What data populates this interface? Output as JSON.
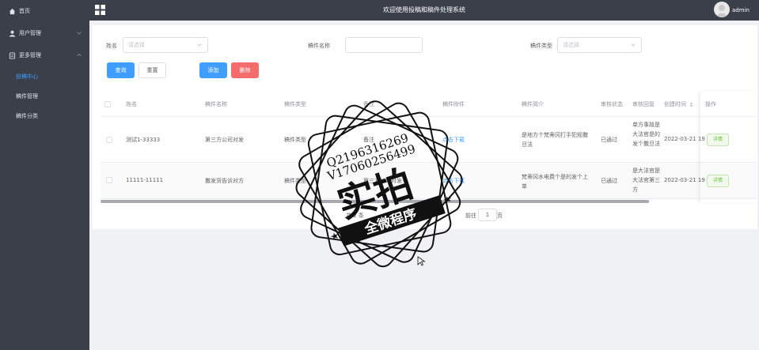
{
  "sidebar": {
    "items": [
      {
        "label": "首页",
        "icon": "home-icon"
      },
      {
        "label": "用户管理",
        "icon": "user-icon"
      },
      {
        "label": "更多管理",
        "icon": "document-icon"
      }
    ],
    "sub_items": [
      {
        "label": "投稿中心",
        "active": true
      },
      {
        "label": "稿件管理",
        "active": false
      },
      {
        "label": "稿件分类",
        "active": false
      }
    ]
  },
  "header": {
    "title": "欢迎使用投稿和稿件处理系统",
    "username": "admin"
  },
  "filters": {
    "name_label": "姓名",
    "name_placeholder": "请选择",
    "manuscript_name_label": "稿件名称",
    "manuscript_name_value": "",
    "manuscript_type_label": "稿件类型",
    "manuscript_type_placeholder": "请选择"
  },
  "buttons": {
    "query": "查询",
    "reset": "重置",
    "add": "添加",
    "delete": "删除"
  },
  "table": {
    "columns": [
      "姓名",
      "稿件名称",
      "稿件类型",
      "备注",
      "稿件附件",
      "稿件简介",
      "审核状态",
      "审核回复",
      "创建时间",
      "操作"
    ],
    "rows": [
      {
        "name": "测试1-33333",
        "manuscript_name": "第三方公司对发",
        "type": "稿件类型",
        "remark": "备注",
        "attachment": "点击下载",
        "intro": "是地方个梵蒂冈打手犯规撒旦法",
        "status": "已通过",
        "reply": "单方事故是大法官是的发个撒旦法",
        "created": "2022-03-21 19",
        "action": "详情"
      },
      {
        "name": "11111-11111",
        "manuscript_name": "撒发货告诉对方",
        "type": "稿件类型",
        "remark": "第三方公司对发",
        "attachment": "点击下载",
        "intro": "梵蒂冈水电费个是的发个上单",
        "status": "已通过",
        "reply": "是大法官是大法官第三方",
        "created": "2022-03-21 19",
        "action": "详情"
      }
    ]
  },
  "pagination": {
    "total": "共 2 条",
    "goto_label": "前往",
    "page": "1",
    "page_suffix": "页"
  },
  "watermark": {
    "line1": "Q2196316269",
    "line2": "V17060256499",
    "big": "实拍",
    "banner": "全微程序"
  },
  "colors": {
    "sidebar_bg": "#3a3f4a",
    "primary": "#409eff",
    "danger": "#f56c6c",
    "success": "#67c23a"
  }
}
